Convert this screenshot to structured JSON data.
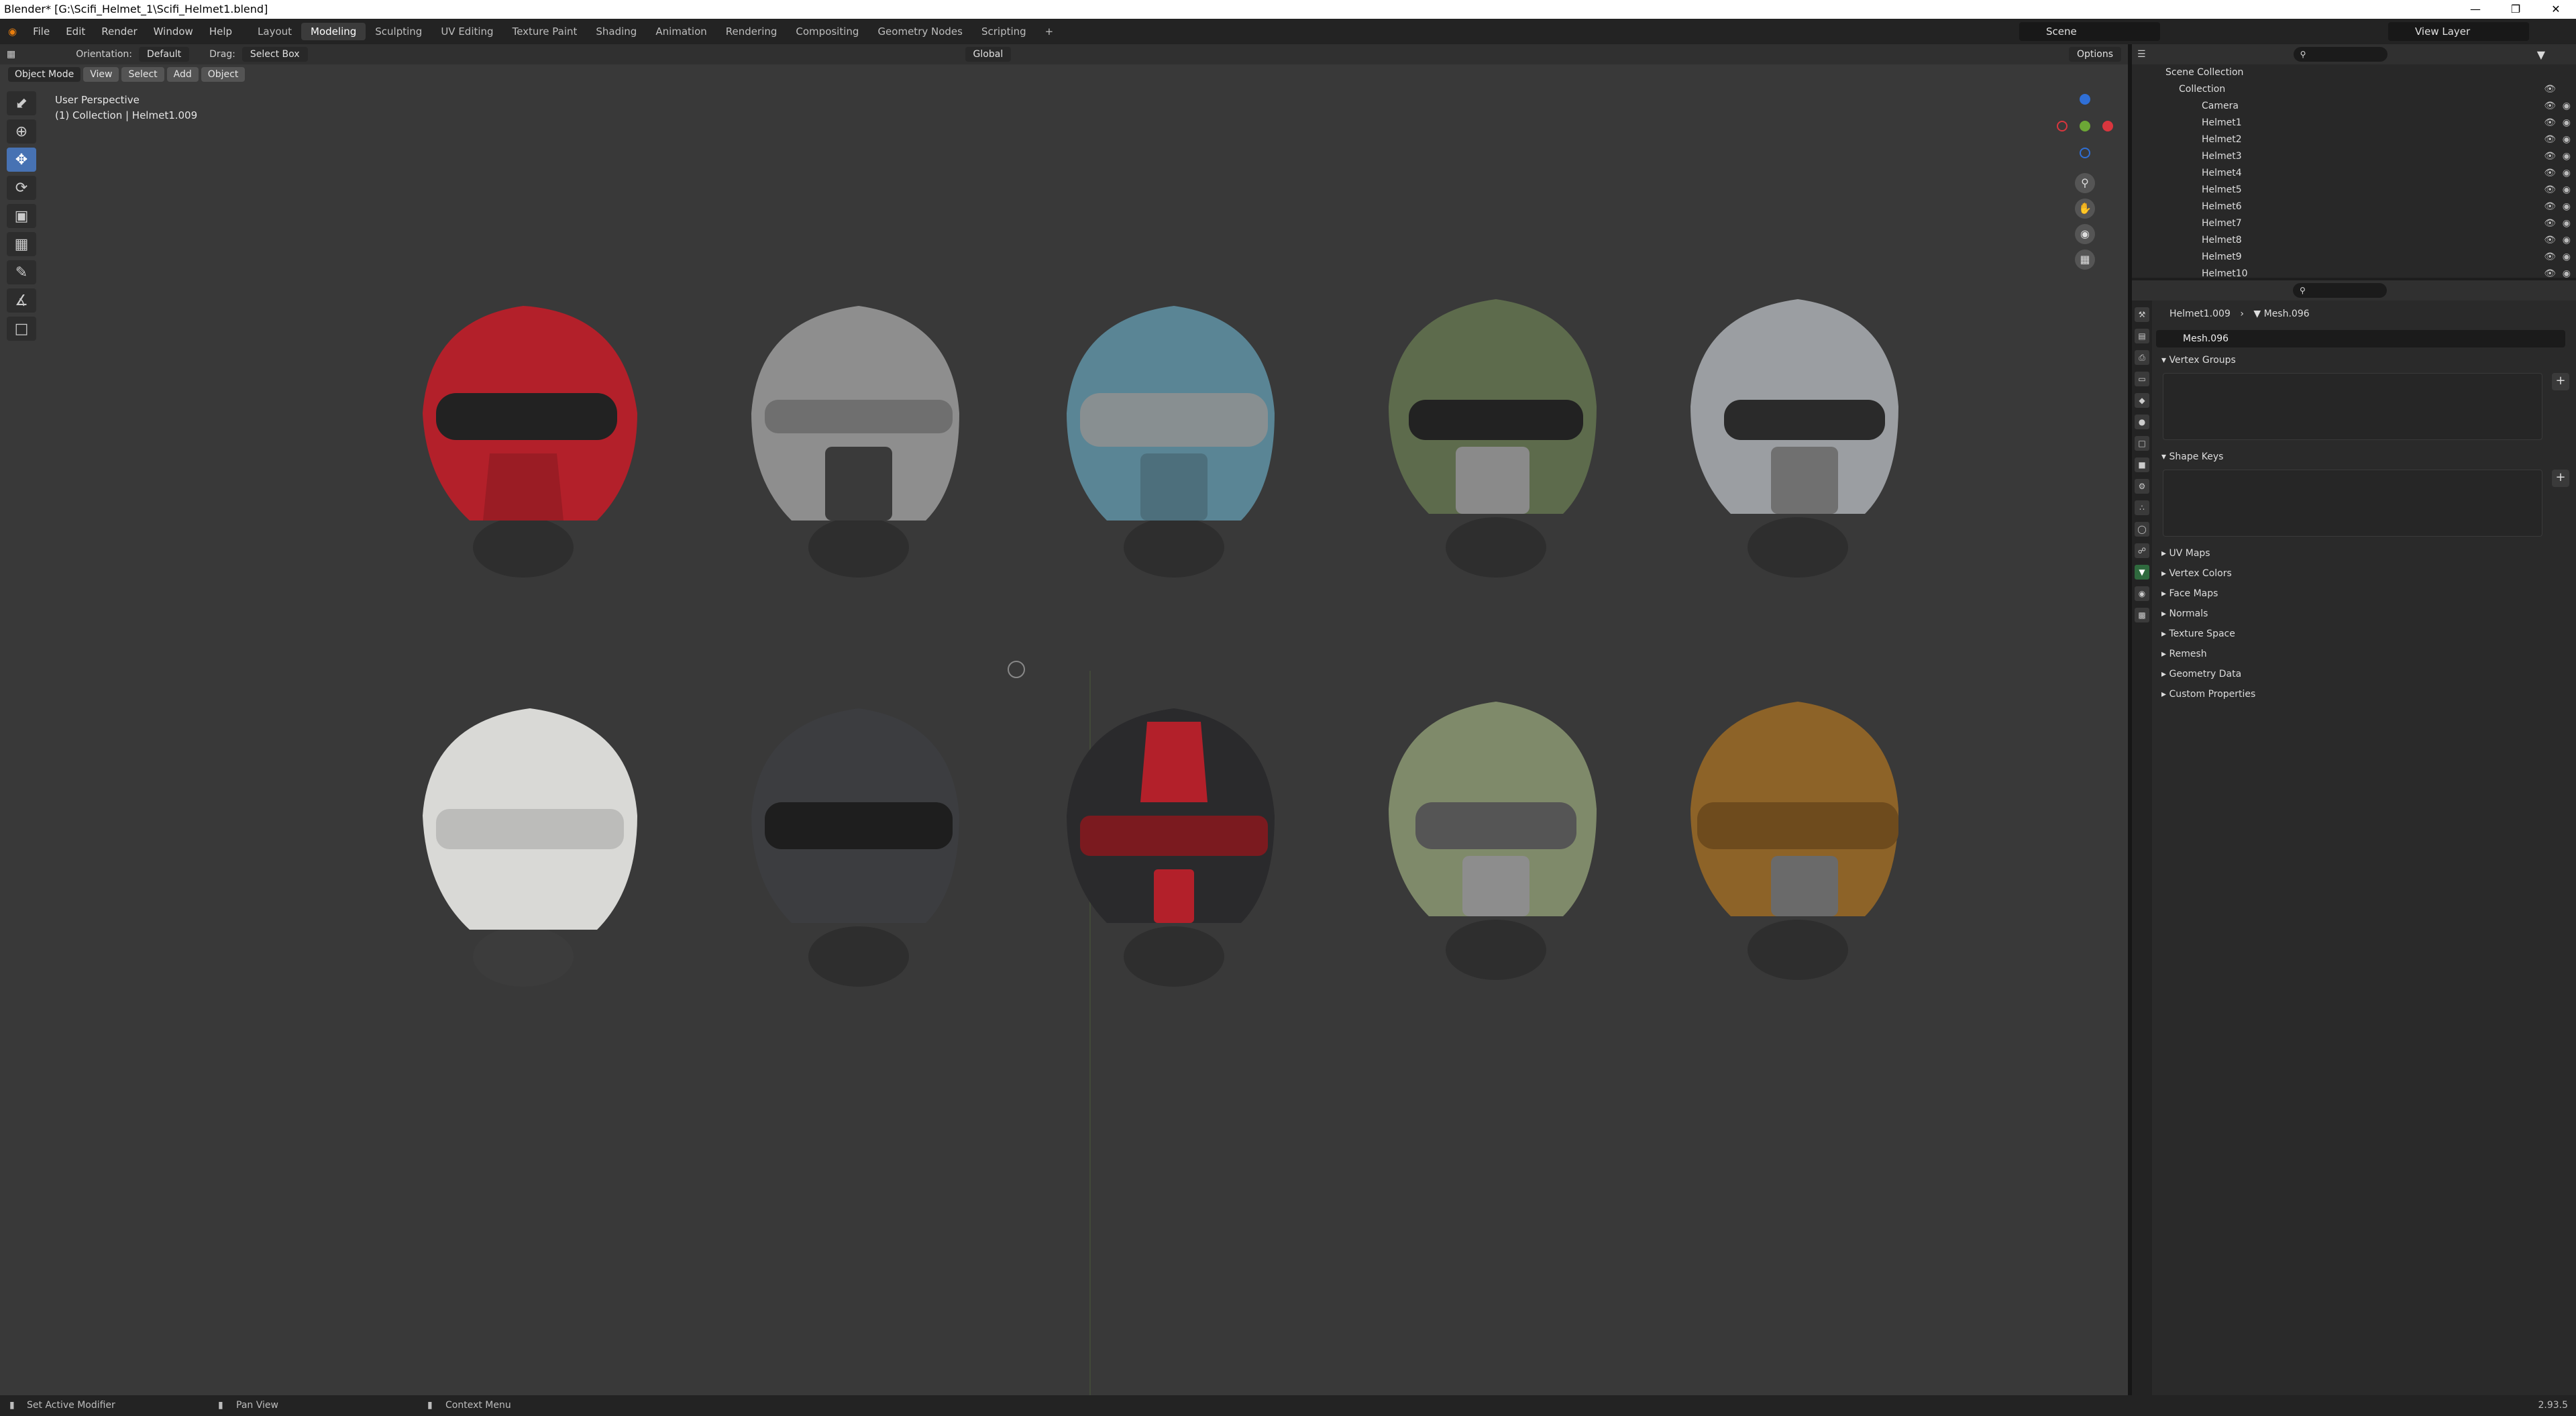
{
  "window": {
    "title": "Blender* [G:\\Scifi_Helmet_1\\Scifi_Helmet1.blend]"
  },
  "menu": [
    "File",
    "Edit",
    "Render",
    "Window",
    "Help"
  ],
  "workspaces": [
    "Layout",
    "Modeling",
    "Sculpting",
    "UV Editing",
    "Texture Paint",
    "Shading",
    "Animation",
    "Rendering",
    "Compositing",
    "Geometry Nodes",
    "Scripting"
  ],
  "active_workspace": "Modeling",
  "scene": {
    "label": "Scene"
  },
  "view_layer": {
    "label": "View Layer"
  },
  "viewport": {
    "header": {
      "orientation_label": "Orientation:",
      "orientation_value": "Default",
      "drag_label": "Drag:",
      "drag_value": "Select Box",
      "transform_orientation": "Global",
      "options": "Options"
    },
    "mode": "Object Mode",
    "view_menu": [
      "View",
      "Select",
      "Add",
      "Object"
    ],
    "info_line1": "User Perspective",
    "info_line2": "(1) Collection | Helmet1.009"
  },
  "outliner": {
    "root": "Scene Collection",
    "collection": "Collection",
    "items": [
      "Camera",
      "Helmet1",
      "Helmet2",
      "Helmet3",
      "Helmet4",
      "Helmet5",
      "Helmet6",
      "Helmet7",
      "Helmet8",
      "Helmet9",
      "Helmet10"
    ]
  },
  "properties": {
    "object": "Helmet1.009",
    "mesh": "Mesh.096",
    "mesh_field": "Mesh.096",
    "panels_open": [
      "Vertex Groups",
      "Shape Keys"
    ],
    "panels_closed": [
      "UV Maps",
      "Vertex Colors",
      "Face Maps",
      "Normals",
      "Texture Space",
      "Remesh",
      "Geometry Data",
      "Custom Properties"
    ]
  },
  "statusbar": {
    "left": "Set Active Modifier",
    "middle": "Pan View",
    "right": "Context Menu",
    "version": "2.93.5"
  },
  "helmet_colors": [
    "#b3202a",
    "#8e8e8e",
    "#5a8595",
    "#5d6b4c",
    "#9b9ea2",
    "#d9d9d6",
    "#3c3d40",
    "#2a2a2c",
    "#7f8a6a",
    "#8d6328"
  ]
}
